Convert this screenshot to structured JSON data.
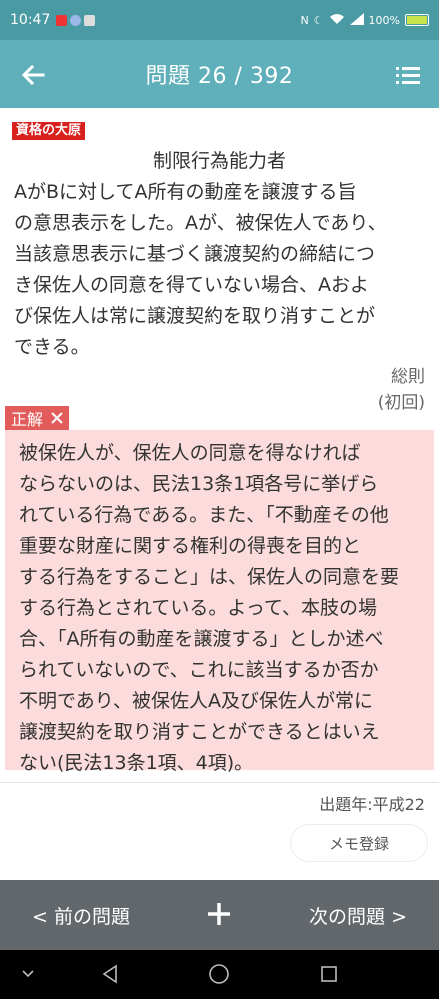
{
  "status_bar": {
    "time": "10:47",
    "battery_text": "100%",
    "colors": {
      "bg": "#4a9aa3"
    }
  },
  "header": {
    "title": "問題 26 / 392",
    "back_icon": "back-arrow-icon",
    "menu_icon": "list-menu-icon"
  },
  "question": {
    "brand": "資格の大原",
    "title": "制限行為能力者",
    "lines": [
      "AがBに対してA所有の動産を譲渡する旨",
      "の意思表示をした。Aが、被保佐人であり、",
      "当該意思表示に基づく譲渡契約の締結につ",
      "き保佐人の同意を得ていない場合、Aおよ",
      "び保佐人は常に譲渡契約を取り消すことが",
      "できる。"
    ],
    "category": "総則",
    "subcategory": "(初回)"
  },
  "answer": {
    "tag_label": "正解",
    "result_icon": "cross-icon",
    "lines": [
      "被保佐人が、保佐人の同意を得なければ",
      "ならないのは、民法13条1項各号に挙げら",
      "れている行為である。また、「不動産その他",
      "重要な財産に関する権利の得喪を目的と",
      "する行為をすること」は、保佐人の同意を要",
      "する行為とされている。よって、本肢の場",
      "合、「A所有の動産を譲渡する」としか述べ",
      "られていないので、これに該当するか否か",
      "不明であり、被保佐人A及び保佐人が常に",
      "譲渡契約を取り消すことができるとはいえ",
      "ない(民法13条1項、4項)。"
    ]
  },
  "footer": {
    "year": "出題年:平成22",
    "memo_label": "メモ登録"
  },
  "bottom_nav": {
    "prev_label": "< 前の問題",
    "add_icon": "plus-icon",
    "next_label": "次の問題 >"
  },
  "colors": {
    "app_bar": "#5fb0ba",
    "brand_red": "#d8201e",
    "answer_tag": "#e35c5c",
    "answer_bg": "#fbdbdb",
    "bottom_nav": "#62676c"
  }
}
